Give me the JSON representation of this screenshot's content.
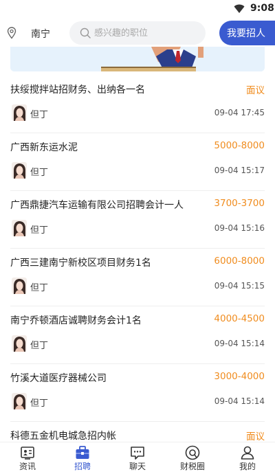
{
  "status": {
    "time": "9:08"
  },
  "header": {
    "location": "南宁",
    "search_placeholder": "感兴趣的职位",
    "post_button": "我要招人"
  },
  "jobs": [
    {
      "title": "扶绥搅拌站招财务、出纳各一名",
      "salary": "面议",
      "poster": "但丁",
      "date": "09-04 17:45"
    },
    {
      "title": "广西新东运水泥",
      "salary": "5000-8000",
      "poster": "但丁",
      "date": "09-04 15:17"
    },
    {
      "title": "广西鼎捷汽车运输有限公司招聘会计一人",
      "salary": "3700-3700",
      "poster": "但丁",
      "date": "09-04 15:16"
    },
    {
      "title": "广西三建南宁新校区项目财务1名",
      "salary": "6000-8000",
      "poster": "但丁",
      "date": "09-04 15:15"
    },
    {
      "title": "南宁乔顿酒店诚聘财务会计1名",
      "salary": "4000-4500",
      "poster": "但丁",
      "date": "09-04 15:14"
    },
    {
      "title": "竹溪大道医疗器械公司",
      "salary": "3000-4000",
      "poster": "但丁",
      "date": "09-04 15:14"
    },
    {
      "title": "科德五金机电城急招内帐",
      "salary": "面议",
      "poster": "",
      "date": ""
    }
  ],
  "tabs": [
    {
      "label": "资讯",
      "icon": "news-icon"
    },
    {
      "label": "招聘",
      "icon": "briefcase-icon"
    },
    {
      "label": "聊天",
      "icon": "chat-icon"
    },
    {
      "label": "财税圈",
      "icon": "circle-icon"
    },
    {
      "label": "我的",
      "icon": "person-icon"
    }
  ],
  "active_tab": "招聘",
  "colors": {
    "accent": "#3a5bd0",
    "salary": "#f08c1e",
    "banner": "#e6f2fc"
  }
}
